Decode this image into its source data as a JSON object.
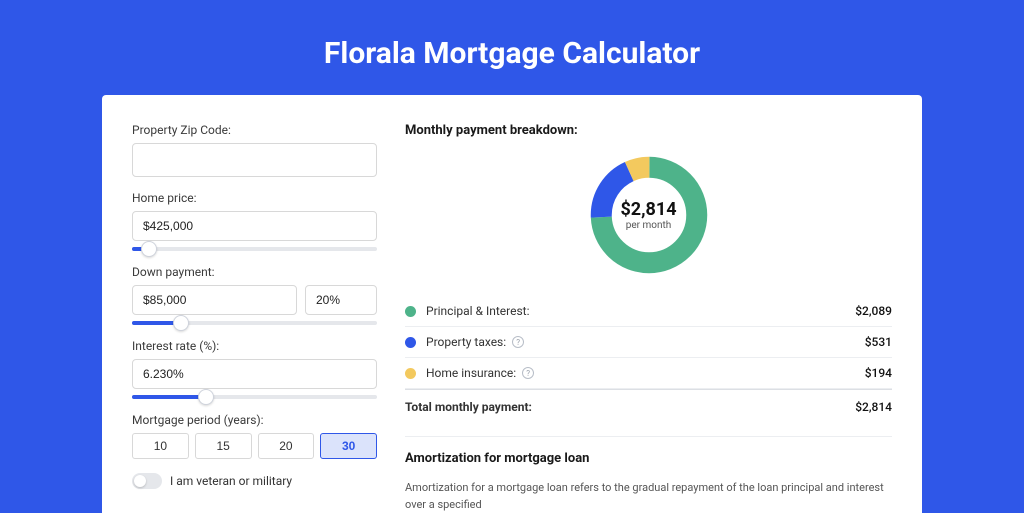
{
  "page_title": "Florala Mortgage Calculator",
  "colors": {
    "principal": "#4eb38a",
    "taxes": "#2f57e8",
    "insurance": "#f3c95e"
  },
  "form": {
    "zip_label": "Property Zip Code:",
    "zip_value": "",
    "home_price_label": "Home price:",
    "home_price_value": "$425,000",
    "home_price_slider_pct": 7,
    "down_payment_label": "Down payment:",
    "down_payment_value": "$85,000",
    "down_payment_pct_value": "20%",
    "down_payment_slider_pct": 20,
    "interest_label": "Interest rate (%):",
    "interest_value": "6.230%",
    "interest_slider_pct": 30,
    "period_label": "Mortgage period (years):",
    "periods": [
      "10",
      "15",
      "20",
      "30"
    ],
    "period_selected": "30",
    "veteran_label": "I am veteran or military"
  },
  "breakdown": {
    "title": "Monthly payment breakdown:",
    "center_amount": "$2,814",
    "center_sub": "per month",
    "items": [
      {
        "label": "Principal & Interest:",
        "value": "$2,089",
        "color_key": "principal",
        "info": false
      },
      {
        "label": "Property taxes:",
        "value": "$531",
        "color_key": "taxes",
        "info": true
      },
      {
        "label": "Home insurance:",
        "value": "$194",
        "color_key": "insurance",
        "info": true
      }
    ],
    "total_label": "Total monthly payment:",
    "total_value": "$2,814"
  },
  "amortization": {
    "title": "Amortization for mortgage loan",
    "text": "Amortization for a mortgage loan refers to the gradual repayment of the loan principal and interest over a specified"
  },
  "chart_data": {
    "type": "pie",
    "title": "Monthly payment breakdown",
    "categories": [
      "Principal & Interest",
      "Property taxes",
      "Home insurance"
    ],
    "values": [
      2089,
      531,
      194
    ],
    "colors": [
      "#4eb38a",
      "#2f57e8",
      "#f3c95e"
    ],
    "total": 2814,
    "center_label": "$2,814 per month"
  }
}
